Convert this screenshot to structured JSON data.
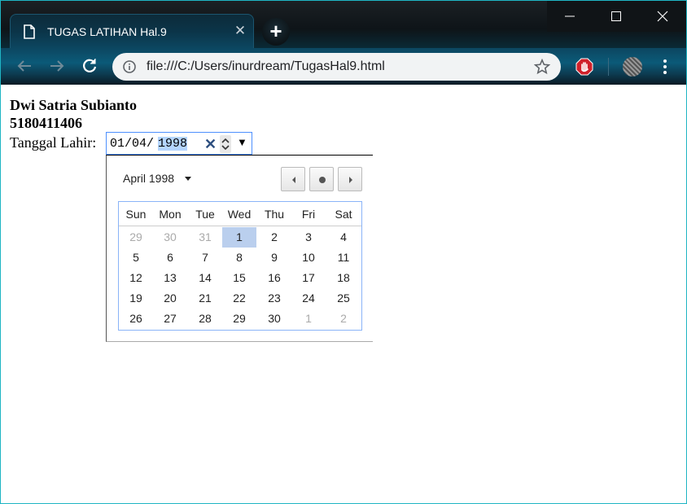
{
  "browser": {
    "tab_title": "TUGAS LATIHAN Hal.9",
    "url": "file:///C:/Users/inurdream/TugasHal9.html"
  },
  "page": {
    "name": "Dwi Satria Subianto",
    "nim": "5180411406",
    "dob_label": "Tanggal Lahir:",
    "date_input": {
      "day": "01",
      "month": "04",
      "year": "1998",
      "sep": "/"
    }
  },
  "calendar": {
    "month_label": "April 1998",
    "weekdays": [
      "Sun",
      "Mon",
      "Tue",
      "Wed",
      "Thu",
      "Fri",
      "Sat"
    ],
    "weeks": [
      [
        "29",
        "30",
        "31",
        "1",
        "2",
        "3",
        "4"
      ],
      [
        "5",
        "6",
        "7",
        "8",
        "9",
        "10",
        "11"
      ],
      [
        "12",
        "13",
        "14",
        "15",
        "16",
        "17",
        "18"
      ],
      [
        "19",
        "20",
        "21",
        "22",
        "23",
        "24",
        "25"
      ],
      [
        "26",
        "27",
        "28",
        "29",
        "30",
        "1",
        "2"
      ]
    ],
    "other_month": [
      [
        0,
        0
      ],
      [
        0,
        1
      ],
      [
        0,
        2
      ],
      [
        4,
        5
      ],
      [
        4,
        6
      ]
    ],
    "selected": [
      0,
      3
    ]
  },
  "icons": {
    "back": "arrow-left-icon",
    "forward": "arrow-right-icon",
    "reload": "reload-icon",
    "info": "info-icon",
    "bookmark": "star-icon",
    "extension": "adblock-hand-icon",
    "menu": "kebab-menu-icon"
  }
}
